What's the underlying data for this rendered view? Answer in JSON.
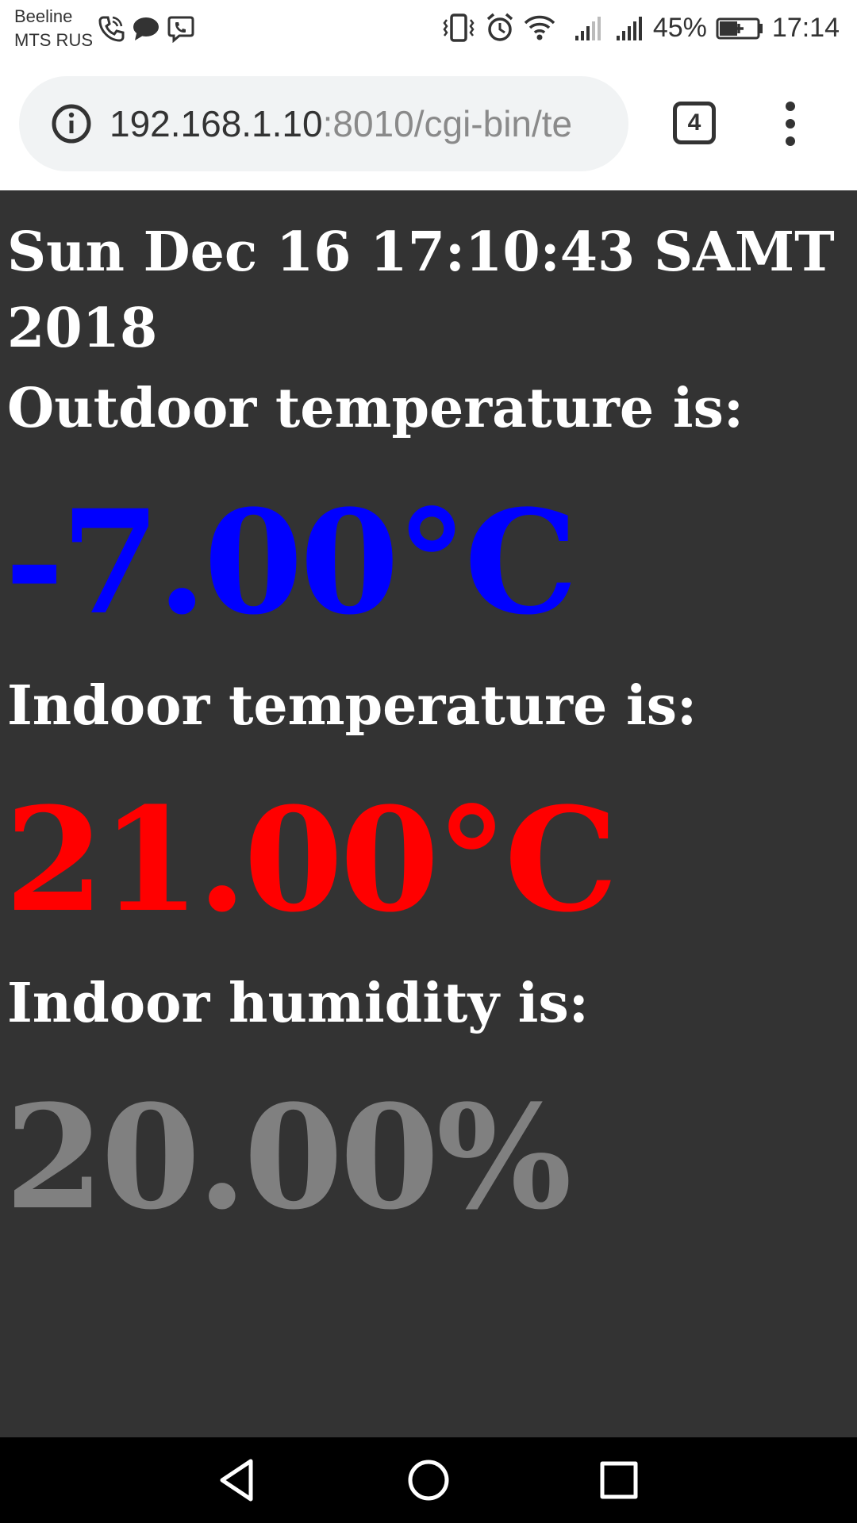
{
  "status_bar": {
    "carrier_1": "Beeline",
    "carrier_2": "MTS RUS",
    "battery_percent": "45%",
    "time": "17:14",
    "icons": [
      "phone-wifi-call-icon",
      "chat-bubble-icon",
      "viber-icon",
      "vibrate-icon",
      "alarm-icon",
      "wifi-icon",
      "signal-icon",
      "signal-icon",
      "battery-charging-icon"
    ]
  },
  "browser": {
    "url_host": "192.168.1.10",
    "url_path": ":8010/cgi-bin/te",
    "tab_count": "4",
    "icons": [
      "info-icon",
      "tab-switcher-icon",
      "more-menu-icon"
    ]
  },
  "page": {
    "datetime": "Sun Dec 16 17:10:43 SAMT 2018",
    "outdoor_label": "Outdoor temperature is:",
    "outdoor_value": "-7.00°C",
    "indoor_label": "Indoor temperature is:",
    "indoor_value": "21.00°C",
    "humidity_label": "Indoor humidity is:",
    "humidity_value": "20.00%",
    "colors": {
      "background": "#333333",
      "text": "#ffffff",
      "outdoor": "#0000ff",
      "indoor": "#ff0000",
      "humidity": "#808080"
    }
  },
  "nav_bar": {
    "icons": [
      "back-triangle-icon",
      "home-circle-icon",
      "recents-square-icon"
    ]
  }
}
